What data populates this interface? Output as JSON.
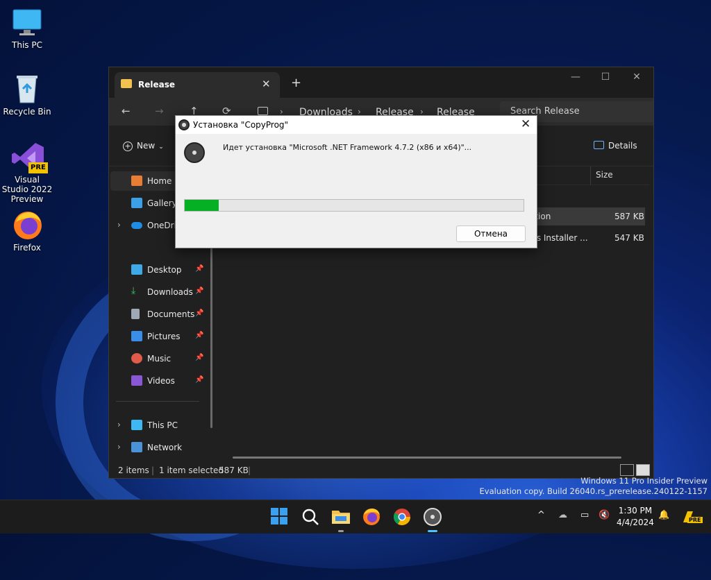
{
  "desktop": {
    "icons": [
      {
        "label": "This PC"
      },
      {
        "label": "Recycle Bin"
      },
      {
        "label": "Visual Studio 2022 Preview",
        "badge": "PRE"
      },
      {
        "label": "Firefox"
      }
    ]
  },
  "explorer": {
    "tab_title": "Release",
    "tab_close": "✕",
    "new_tab": "+",
    "controls": {
      "minimize": "—",
      "maximize": "☐",
      "close": "✕"
    },
    "nav": {
      "back": "←",
      "forward": "→",
      "up": "↑",
      "refresh": "⟳"
    },
    "breadcrumb": [
      "Downloads",
      "Release",
      "Release"
    ],
    "search_placeholder": "Search Release",
    "toolbar": {
      "new_label": "New",
      "details_label": "Details"
    },
    "sidebar": [
      {
        "label": "Home",
        "active": true
      },
      {
        "label": "Gallery"
      },
      {
        "label": "OneDrive"
      },
      {
        "label": "Desktop",
        "pinned": true
      },
      {
        "label": "Downloads",
        "pinned": true
      },
      {
        "label": "Documents",
        "pinned": true
      },
      {
        "label": "Pictures",
        "pinned": true
      },
      {
        "label": "Music",
        "pinned": true
      },
      {
        "label": "Videos",
        "pinned": true
      },
      {
        "label": "This PC"
      },
      {
        "label": "Network"
      }
    ],
    "columns": {
      "size": "Size"
    },
    "files": [
      {
        "name": "ation",
        "size": "587 KB",
        "selected": true
      },
      {
        "name": "ws Installer ...",
        "size": "547 KB",
        "selected": false
      }
    ],
    "status": {
      "items": "2 items",
      "selected": "1 item selected",
      "size": "587 KB"
    }
  },
  "dialog": {
    "title": "Установка \"CopyProg\"",
    "close": "✕",
    "message": "Идет установка \"Microsoft .NET Framework 4.7.2 (x86 и x64)\"...",
    "progress": 0.1,
    "cancel_label": "Отмена"
  },
  "watermark": {
    "line1": "Windows 11 Pro Insider Preview",
    "line2": "Evaluation copy. Build 26040.rs_prerelease.240122-1157"
  },
  "taskbar": {
    "time": "1:30 PM",
    "date": "4/4/2024",
    "tray_chevron": "^",
    "badge": "PRE"
  },
  "colors": {
    "progress": "#06b025",
    "accent": "#0078d4"
  }
}
